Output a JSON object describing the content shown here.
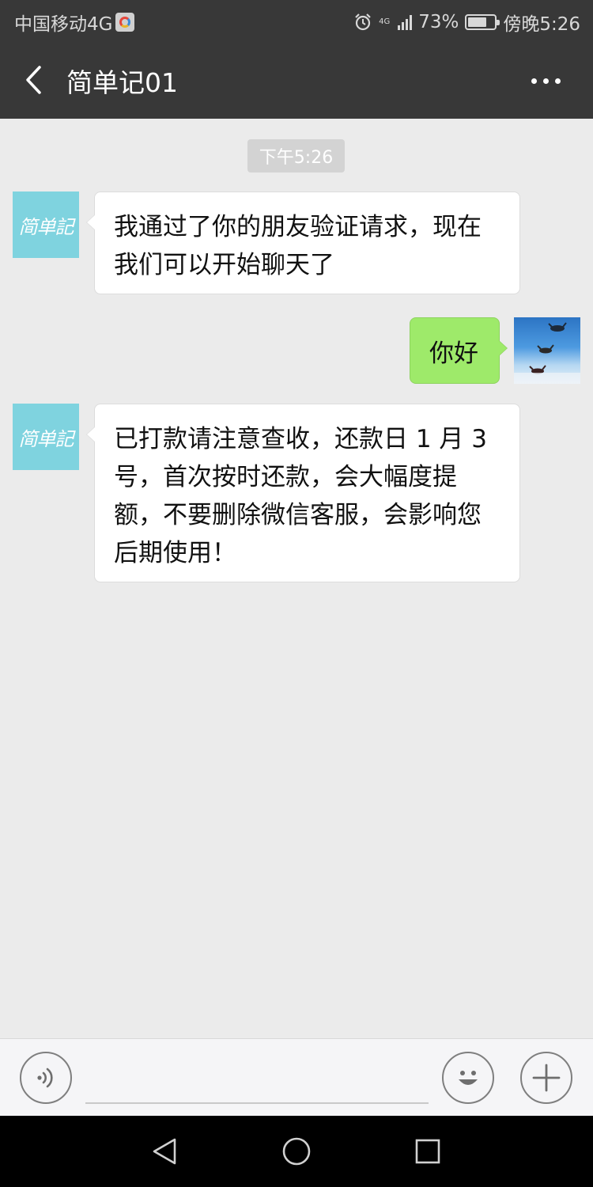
{
  "status_bar": {
    "carrier": "中国移动4G",
    "network": "4G",
    "battery": "73%",
    "battery_level": 0.73,
    "time": "傍晚5:26",
    "icons": [
      "app-notification-icon",
      "alarm-icon",
      "signal-icon",
      "battery-icon"
    ]
  },
  "header": {
    "title": "简单记01",
    "back_icon": "chevron-left-icon",
    "more_icon": "more-dots-icon",
    "bar_color": "#383838"
  },
  "chat": {
    "timestamp": "下午5:26",
    "contact_avatar_text": "简单記",
    "self_avatar": "skydivers-photo",
    "messages": [
      {
        "from": "contact",
        "text": "我通过了你的朋友验证请求，现在我们可以开始聊天了"
      },
      {
        "from": "self",
        "text": "你好"
      },
      {
        "from": "contact",
        "text": "已打款请注意查收，还款日 1 月 3 号，首次按时还款，会大幅度提额，不要删除微信客服，会影响您后期使用！"
      }
    ]
  },
  "input_bar": {
    "voice_icon": "voice-input-icon",
    "emoji_icon": "emoji-icon",
    "plus_icon": "add-plus-icon",
    "placeholder": ""
  },
  "system_nav": {
    "icons": [
      "back-triangle-icon",
      "home-circle-icon",
      "recent-apps-square-icon"
    ]
  },
  "colors": {
    "incoming_bubble": "#ffffff",
    "outgoing_bubble": "#9eea6a",
    "chat_background": "#ebebeb",
    "avatar_brand": "#7fd3df"
  }
}
